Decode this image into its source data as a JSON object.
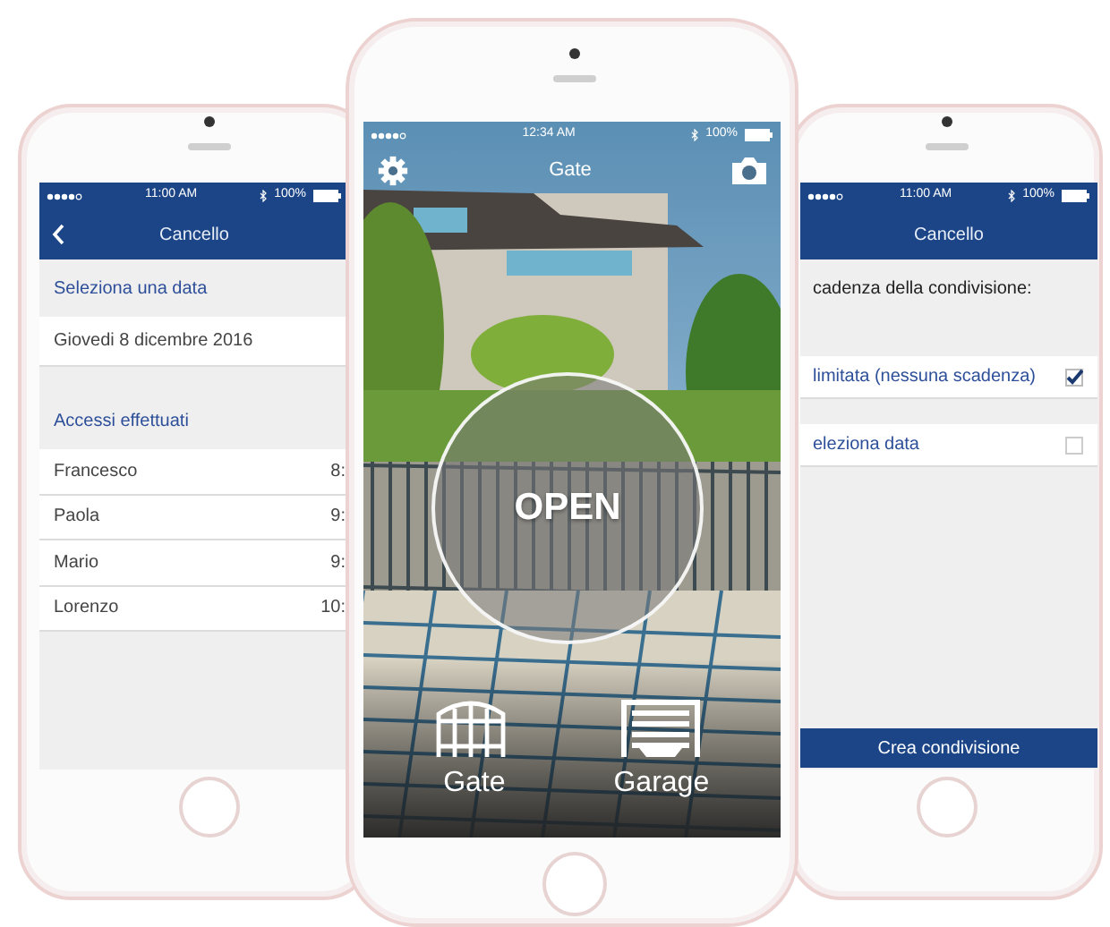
{
  "left_phone": {
    "status_bar": {
      "time": "11:00 AM",
      "battery": "100%"
    },
    "nav_title": "Cancello",
    "date_section": {
      "header": "Seleziona una data",
      "value": "Giovedi 8 dicembre 2016"
    },
    "access_section": {
      "header": "Accessi effettuati",
      "rows": [
        {
          "name": "Francesco",
          "time": "8:"
        },
        {
          "name": "Paola",
          "time": "9:"
        },
        {
          "name": "Mario",
          "time": "9:"
        },
        {
          "name": "Lorenzo",
          "time": "10:"
        }
      ]
    }
  },
  "center_phone": {
    "status_bar": {
      "time": "12:34 AM",
      "battery": "100%"
    },
    "title": "Gate",
    "open_button": "OPEN",
    "devices": [
      {
        "label": "Gate",
        "kind": "gate"
      },
      {
        "label": "Garage",
        "kind": "garage"
      }
    ]
  },
  "right_phone": {
    "status_bar": {
      "time": "11:00 AM",
      "battery": "100%"
    },
    "nav_title": "Cancello",
    "prompt": "cadenza della condivisione:",
    "options": [
      {
        "label": "limitata (nessuna scadenza)",
        "checked": true
      },
      {
        "label": "eleziona data",
        "checked": false
      }
    ],
    "button": "Crea condivisione"
  }
}
